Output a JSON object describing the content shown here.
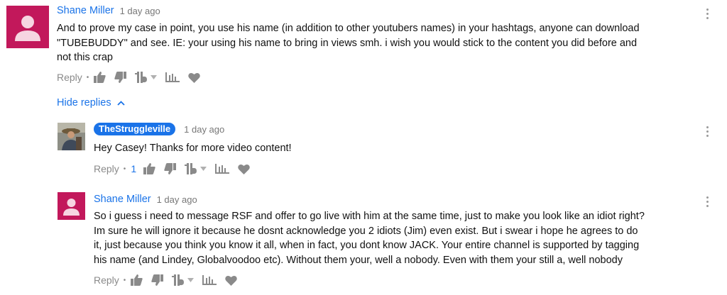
{
  "comments": [
    {
      "author": "Shane Miller",
      "time": "1 day ago",
      "lines": [
        "And to prove my case in point, you use his name (in addition to other youtubers names) in your hashtags, anyone can download",
        "\"TUBEBUDDY\" and see. IE: your using his name to bring in views smh. i wish you would stick to the content you did before and",
        "not this crap"
      ],
      "reply_label": "Reply"
    },
    {
      "author": "TheStruggleville",
      "time": "1 day ago",
      "lines": [
        "Hey Casey!  Thanks for more video content!"
      ],
      "reply_label": "Reply",
      "like_count": "1"
    },
    {
      "author": "Shane Miller",
      "time": "1 day ago",
      "lines": [
        "So i guess i need to message RSF and offer to go live with him at the same time, just to make you look like an idiot right?",
        "Im sure he will ignore it because he dosnt acknowledge you 2 idiots (Jim) even exist. But i swear i hope he agrees to do",
        "it, just because you think you know it all, when in fact, you dont know JACK. Your entire channel is supported by tagging",
        "his name (and Lindey, Globalvoodoo etc). Without them your, well a nobody. Even with them your still a, well nobody"
      ],
      "reply_label": "Reply"
    }
  ],
  "hide_replies_label": "Hide replies",
  "colors": {
    "link": "#1a73e8",
    "avatar": "#c2185b",
    "muted": "#8a8a8a"
  },
  "icons": [
    "thumbs-up-icon",
    "thumbs-down-icon",
    "tubebuddy-icon",
    "chevron-down-icon",
    "stats-icon",
    "heart-icon",
    "chevron-up-icon",
    "more-vert-icon"
  ]
}
